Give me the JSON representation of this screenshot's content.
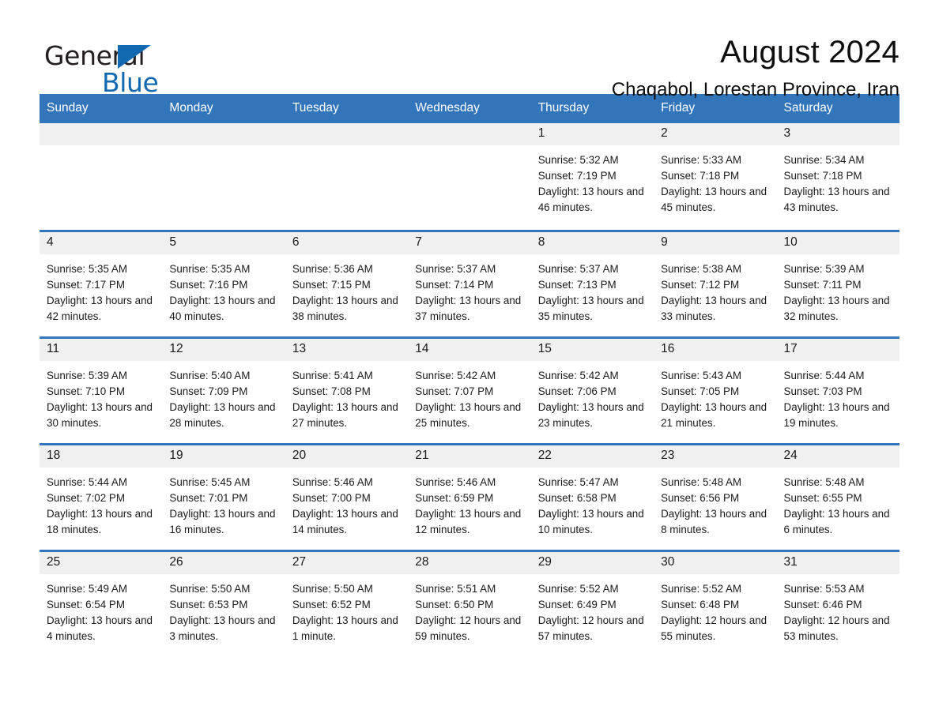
{
  "brand": {
    "name_part1": "General",
    "name_part2": "Blue",
    "accent_color": "#1269b0"
  },
  "header": {
    "title": "August 2024",
    "subtitle": "Chaqabol, Lorestan Province, Iran"
  },
  "calendar": {
    "header_bg": "#3275ba",
    "daynum_bg": "#f0f0f0",
    "weekdays": [
      "Sunday",
      "Monday",
      "Tuesday",
      "Wednesday",
      "Thursday",
      "Friday",
      "Saturday"
    ],
    "weeks": [
      [
        {
          "day": ""
        },
        {
          "day": ""
        },
        {
          "day": ""
        },
        {
          "day": ""
        },
        {
          "day": "1",
          "sunrise": "Sunrise: 5:32 AM",
          "sunset": "Sunset: 7:19 PM",
          "daylight": "Daylight: 13 hours and 46 minutes."
        },
        {
          "day": "2",
          "sunrise": "Sunrise: 5:33 AM",
          "sunset": "Sunset: 7:18 PM",
          "daylight": "Daylight: 13 hours and 45 minutes."
        },
        {
          "day": "3",
          "sunrise": "Sunrise: 5:34 AM",
          "sunset": "Sunset: 7:18 PM",
          "daylight": "Daylight: 13 hours and 43 minutes."
        }
      ],
      [
        {
          "day": "4",
          "sunrise": "Sunrise: 5:35 AM",
          "sunset": "Sunset: 7:17 PM",
          "daylight": "Daylight: 13 hours and 42 minutes."
        },
        {
          "day": "5",
          "sunrise": "Sunrise: 5:35 AM",
          "sunset": "Sunset: 7:16 PM",
          "daylight": "Daylight: 13 hours and 40 minutes."
        },
        {
          "day": "6",
          "sunrise": "Sunrise: 5:36 AM",
          "sunset": "Sunset: 7:15 PM",
          "daylight": "Daylight: 13 hours and 38 minutes."
        },
        {
          "day": "7",
          "sunrise": "Sunrise: 5:37 AM",
          "sunset": "Sunset: 7:14 PM",
          "daylight": "Daylight: 13 hours and 37 minutes."
        },
        {
          "day": "8",
          "sunrise": "Sunrise: 5:37 AM",
          "sunset": "Sunset: 7:13 PM",
          "daylight": "Daylight: 13 hours and 35 minutes."
        },
        {
          "day": "9",
          "sunrise": "Sunrise: 5:38 AM",
          "sunset": "Sunset: 7:12 PM",
          "daylight": "Daylight: 13 hours and 33 minutes."
        },
        {
          "day": "10",
          "sunrise": "Sunrise: 5:39 AM",
          "sunset": "Sunset: 7:11 PM",
          "daylight": "Daylight: 13 hours and 32 minutes."
        }
      ],
      [
        {
          "day": "11",
          "sunrise": "Sunrise: 5:39 AM",
          "sunset": "Sunset: 7:10 PM",
          "daylight": "Daylight: 13 hours and 30 minutes."
        },
        {
          "day": "12",
          "sunrise": "Sunrise: 5:40 AM",
          "sunset": "Sunset: 7:09 PM",
          "daylight": "Daylight: 13 hours and 28 minutes."
        },
        {
          "day": "13",
          "sunrise": "Sunrise: 5:41 AM",
          "sunset": "Sunset: 7:08 PM",
          "daylight": "Daylight: 13 hours and 27 minutes."
        },
        {
          "day": "14",
          "sunrise": "Sunrise: 5:42 AM",
          "sunset": "Sunset: 7:07 PM",
          "daylight": "Daylight: 13 hours and 25 minutes."
        },
        {
          "day": "15",
          "sunrise": "Sunrise: 5:42 AM",
          "sunset": "Sunset: 7:06 PM",
          "daylight": "Daylight: 13 hours and 23 minutes."
        },
        {
          "day": "16",
          "sunrise": "Sunrise: 5:43 AM",
          "sunset": "Sunset: 7:05 PM",
          "daylight": "Daylight: 13 hours and 21 minutes."
        },
        {
          "day": "17",
          "sunrise": "Sunrise: 5:44 AM",
          "sunset": "Sunset: 7:03 PM",
          "daylight": "Daylight: 13 hours and 19 minutes."
        }
      ],
      [
        {
          "day": "18",
          "sunrise": "Sunrise: 5:44 AM",
          "sunset": "Sunset: 7:02 PM",
          "daylight": "Daylight: 13 hours and 18 minutes."
        },
        {
          "day": "19",
          "sunrise": "Sunrise: 5:45 AM",
          "sunset": "Sunset: 7:01 PM",
          "daylight": "Daylight: 13 hours and 16 minutes."
        },
        {
          "day": "20",
          "sunrise": "Sunrise: 5:46 AM",
          "sunset": "Sunset: 7:00 PM",
          "daylight": "Daylight: 13 hours and 14 minutes."
        },
        {
          "day": "21",
          "sunrise": "Sunrise: 5:46 AM",
          "sunset": "Sunset: 6:59 PM",
          "daylight": "Daylight: 13 hours and 12 minutes."
        },
        {
          "day": "22",
          "sunrise": "Sunrise: 5:47 AM",
          "sunset": "Sunset: 6:58 PM",
          "daylight": "Daylight: 13 hours and 10 minutes."
        },
        {
          "day": "23",
          "sunrise": "Sunrise: 5:48 AM",
          "sunset": "Sunset: 6:56 PM",
          "daylight": "Daylight: 13 hours and 8 minutes."
        },
        {
          "day": "24",
          "sunrise": "Sunrise: 5:48 AM",
          "sunset": "Sunset: 6:55 PM",
          "daylight": "Daylight: 13 hours and 6 minutes."
        }
      ],
      [
        {
          "day": "25",
          "sunrise": "Sunrise: 5:49 AM",
          "sunset": "Sunset: 6:54 PM",
          "daylight": "Daylight: 13 hours and 4 minutes."
        },
        {
          "day": "26",
          "sunrise": "Sunrise: 5:50 AM",
          "sunset": "Sunset: 6:53 PM",
          "daylight": "Daylight: 13 hours and 3 minutes."
        },
        {
          "day": "27",
          "sunrise": "Sunrise: 5:50 AM",
          "sunset": "Sunset: 6:52 PM",
          "daylight": "Daylight: 13 hours and 1 minute."
        },
        {
          "day": "28",
          "sunrise": "Sunrise: 5:51 AM",
          "sunset": "Sunset: 6:50 PM",
          "daylight": "Daylight: 12 hours and 59 minutes."
        },
        {
          "day": "29",
          "sunrise": "Sunrise: 5:52 AM",
          "sunset": "Sunset: 6:49 PM",
          "daylight": "Daylight: 12 hours and 57 minutes."
        },
        {
          "day": "30",
          "sunrise": "Sunrise: 5:52 AM",
          "sunset": "Sunset: 6:48 PM",
          "daylight": "Daylight: 12 hours and 55 minutes."
        },
        {
          "day": "31",
          "sunrise": "Sunrise: 5:53 AM",
          "sunset": "Sunset: 6:46 PM",
          "daylight": "Daylight: 12 hours and 53 minutes."
        }
      ]
    ]
  }
}
